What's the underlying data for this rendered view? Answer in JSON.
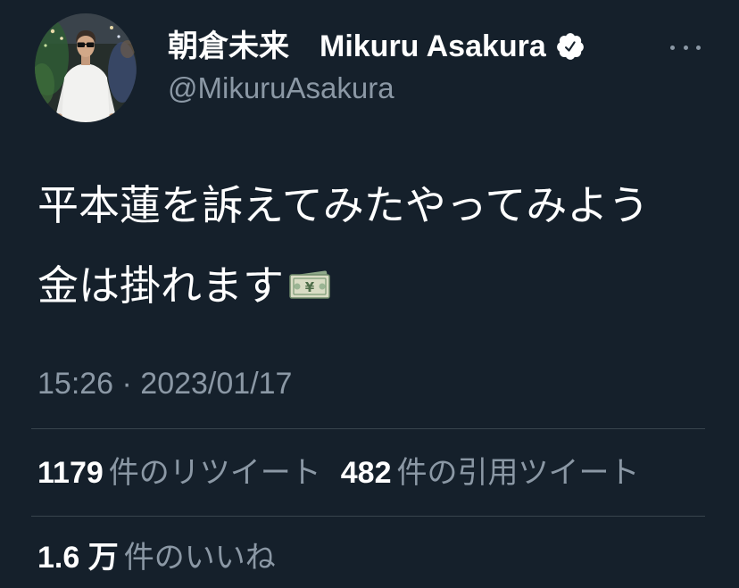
{
  "user": {
    "display_name": "朝倉未来　Mikuru Asakura",
    "handle": "@MikuruAsakura",
    "avatar_icon": "profile-photo",
    "verified_icon": "verified-badge"
  },
  "menu": {
    "more_icon": "more-horizontal-dots"
  },
  "tweet": {
    "line_1": "平本蓮を訴えてみたやってみよう",
    "line_2": "金は掛れます",
    "emoji_icon": "yen-banknote"
  },
  "timestamp": "15:26 · 2023/01/17",
  "stats": {
    "retweets": {
      "count": "1179",
      "label": "件のリツイート"
    },
    "quotes": {
      "count": "482",
      "label": "件の引用ツイート"
    },
    "likes": {
      "count": "1.6 万",
      "label": "件のいいね"
    }
  },
  "colors": {
    "background": "#15202b",
    "primary_text": "#ffffff",
    "secondary_text": "#8b98a5",
    "divider": "#38444d"
  }
}
